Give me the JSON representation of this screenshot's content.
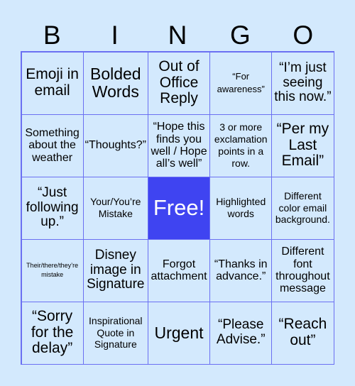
{
  "header": {
    "letters": [
      "B",
      "I",
      "N",
      "G",
      "O"
    ]
  },
  "colors": {
    "background": "#d3e9fd",
    "grid_line": "#6b70f2",
    "free_cell": "#3f44f1",
    "free_text": "#ffffff"
  },
  "grid": {
    "rows": [
      [
        "Emoji in email",
        "Bolded Words",
        "Out of Office Reply",
        "“For awareness”",
        "“I’m just seeing this now.”"
      ],
      [
        "Something about the weather",
        "“Thoughts?”",
        "“Hope this finds you well / Hope all’s well”",
        "3 or more exclamation points in a row.",
        "“Per my Last Email”"
      ],
      [
        "“Just following up.”",
        "Your/You’re Mistake",
        "Free!",
        "Highlighted words",
        "Different color email background."
      ],
      [
        "Their/there/they’re mistake",
        "Disney image in Signature",
        "Forgot attachment",
        "“Thanks in advance.”",
        "Different font throughout message"
      ],
      [
        "“Sorry for the delay”",
        "Inspirational Quote in Signature",
        "Urgent",
        "“Please Advise.”",
        "“Reach out”"
      ]
    ],
    "free_cell": {
      "row": 2,
      "col": 2
    }
  }
}
